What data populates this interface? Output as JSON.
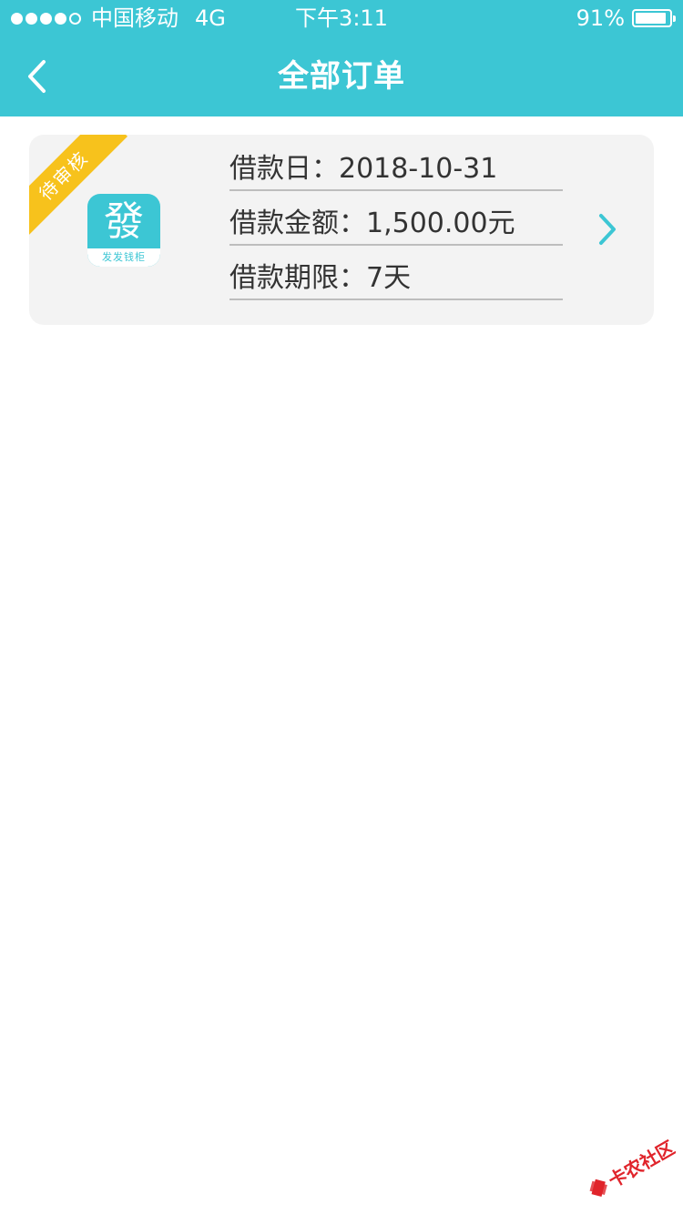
{
  "status_bar": {
    "carrier": "中国移动",
    "network": "4G",
    "time": "下午3:11",
    "battery_percent": "91%",
    "battery_level": 0.91,
    "signal_bars_filled": 4,
    "signal_bars_total": 5
  },
  "nav": {
    "title": "全部订单",
    "back_icon": "chevron-left-icon"
  },
  "order": {
    "status_ribbon": "待审核",
    "app_logo_char": "發",
    "app_logo_caption": "发发钱柜",
    "loan_date_label": "借款日：",
    "loan_date": "2018-10-31",
    "loan_amount_label": "借款金额：",
    "loan_amount": "1,500.00元",
    "loan_term_label": "借款期限：",
    "loan_term": "7天",
    "detail_icon": "chevron-right-icon"
  },
  "watermark": {
    "text": "卡农社区"
  },
  "colors": {
    "primary": "#3cc6d4",
    "ribbon": "#f7c21c",
    "card_bg": "#f3f3f3",
    "text": "#333333",
    "watermark": "#e0242b"
  }
}
